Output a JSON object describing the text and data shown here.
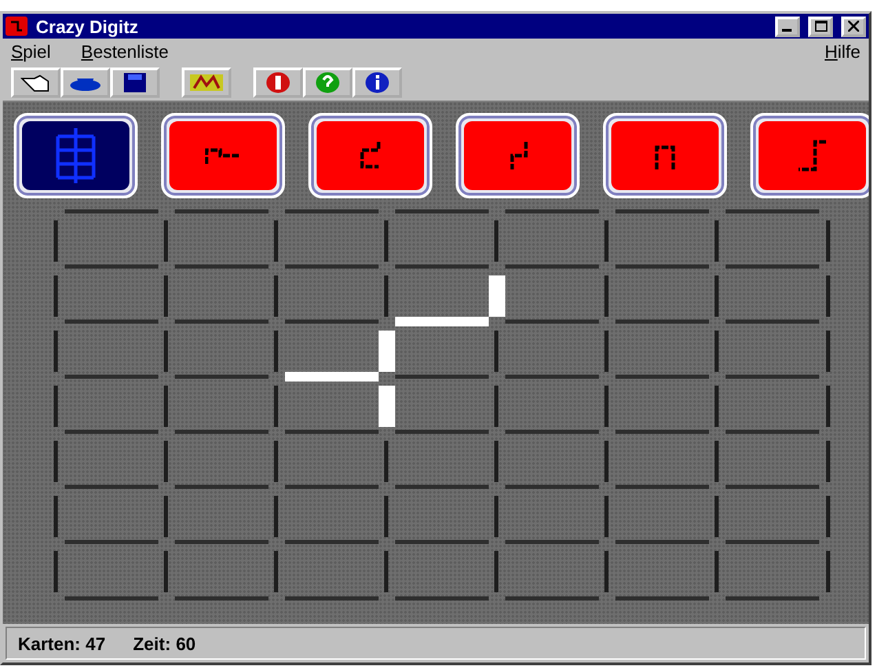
{
  "window": {
    "title": "Crazy Digitz"
  },
  "menu": [
    {
      "label": "Spiel"
    },
    {
      "label": "Bestenliste"
    },
    {
      "label": "Hilfe"
    }
  ],
  "tiles": [
    {
      "kind": "joker",
      "selected": true
    },
    {
      "kind": "piece",
      "selected": false
    },
    {
      "kind": "piece",
      "selected": false
    },
    {
      "kind": "piece",
      "selected": false
    },
    {
      "kind": "piece",
      "selected": false
    },
    {
      "kind": "piece",
      "selected": false
    }
  ],
  "board": {
    "horizontal": [
      [
        false,
        false,
        false,
        false,
        false,
        false,
        false
      ],
      [
        false,
        false,
        false,
        false,
        false,
        false,
        false
      ],
      [
        false,
        false,
        false,
        true,
        false,
        false,
        false
      ],
      [
        false,
        false,
        true,
        false,
        false,
        false,
        false
      ],
      [
        false,
        false,
        false,
        false,
        false,
        false,
        false
      ],
      [
        false,
        false,
        false,
        false,
        false,
        false,
        false
      ],
      [
        false,
        false,
        false,
        false,
        false,
        false,
        false
      ],
      [
        false,
        false,
        false,
        false,
        false,
        false,
        false
      ]
    ],
    "vertical": [
      [
        false,
        false,
        false,
        false,
        false,
        false,
        false,
        false
      ],
      [
        false,
        false,
        false,
        false,
        true,
        false,
        false,
        false
      ],
      [
        false,
        false,
        false,
        true,
        false,
        false,
        false,
        false
      ],
      [
        false,
        false,
        false,
        true,
        false,
        false,
        false,
        false
      ],
      [
        false,
        false,
        false,
        false,
        false,
        false,
        false,
        false
      ],
      [
        false,
        false,
        false,
        false,
        false,
        false,
        false,
        false
      ],
      [
        false,
        false,
        false,
        false,
        false,
        false,
        false,
        false
      ]
    ]
  },
  "status_bar": [
    {
      "label": "Karten:",
      "value": "47"
    },
    {
      "label": "Zeit:",
      "value": "60"
    }
  ]
}
